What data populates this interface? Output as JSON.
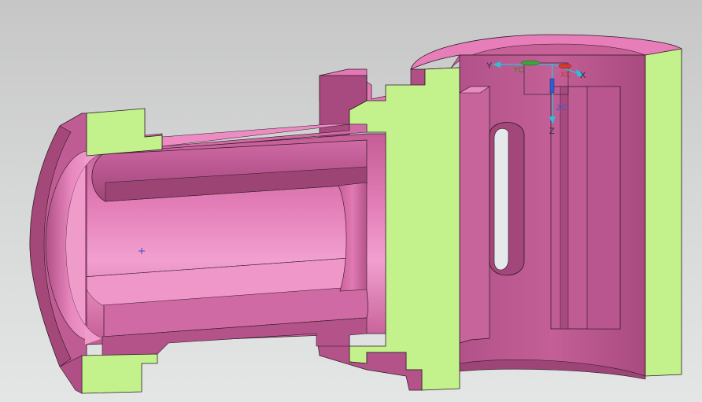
{
  "viewport": {
    "background_top": "#c6c6c6",
    "background_bottom": "#e4e6e6"
  },
  "model": {
    "colors": {
      "section_face": "#c3f28c",
      "body_dark": "#a4487a",
      "body_mid": "#c15c92",
      "body_light": "#e07ab4",
      "body_highlight": "#f5a2d3",
      "edge": "#2a1a22"
    }
  },
  "triad": {
    "labels": {
      "x": "X",
      "y": "Y",
      "z": "Z",
      "xc": "XC",
      "yc": "YC",
      "zc": "ZC"
    },
    "colors": {
      "x": "#d33a2c",
      "y": "#3aa63a",
      "z": "#2f5fd0",
      "cyan": "#27c4d6"
    }
  },
  "cursor": {
    "icon": "crosshair-icon",
    "color": "#3b49c8"
  }
}
